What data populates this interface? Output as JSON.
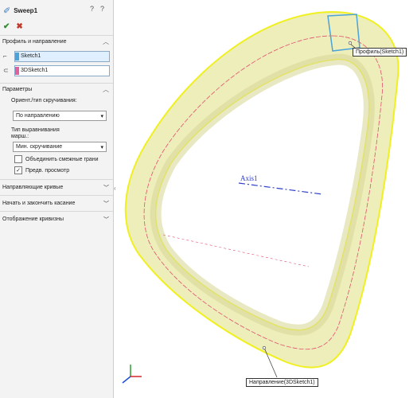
{
  "feature": {
    "title": "Sweep1",
    "help1": "?",
    "help2": "?"
  },
  "actions": {
    "ok": "✔",
    "cancel": "✖"
  },
  "profile_section": {
    "heading": "Профиль и направление",
    "profile_value": "Sketch1",
    "path_value": "3DSketch1"
  },
  "params_section": {
    "heading": "Параметры",
    "orient_label": "Ориент./тип скручивания:",
    "orient_value": "По направлению",
    "align_label_1": "Тип выравнивания",
    "align_label_2": "марш.:",
    "align_value": "Мин. скручивание",
    "merge_label": "Объединить смежные грани",
    "preview_label": "Предв. просмотр",
    "preview_checked": true,
    "merge_checked": false
  },
  "collapsed_sections": [
    "Направляющие кривые",
    "Начать и закончить касание",
    "Отображение кривизны"
  ],
  "viewport": {
    "axis_label": "Axis1",
    "profile_callout": "Профиль(Sketch1)",
    "path_callout": "Направление(3DSketch1)"
  },
  "colors": {
    "surface": "#efefb9",
    "edge": "#f0f020",
    "path": "#e05070",
    "axis": "#2f3fc7",
    "selection": "#4aa3d9"
  }
}
